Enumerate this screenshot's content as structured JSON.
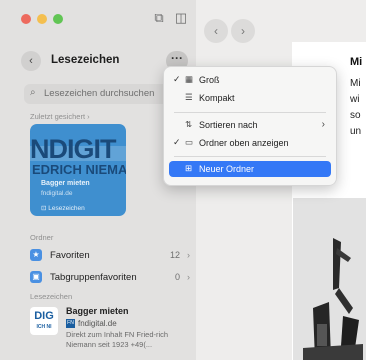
{
  "sidebar": {
    "title": "Lesezeichen",
    "back_icon": "‹",
    "more_icon": "···",
    "search_placeholder": "Lesezeichen durchsuchen",
    "recent_label": "Zuletzt gesichert",
    "recent_chevron": "›",
    "card": {
      "logo_line1": "NDIGIT",
      "logo_line2": "EDRICH NIEMA",
      "title": "Bagger mieten",
      "domain": "fndigital.de",
      "tag": "Lesezeichen"
    },
    "folder_label": "Ordner",
    "folders": [
      {
        "label": "Favoriten",
        "count": "12",
        "icon": "star-icon"
      },
      {
        "label": "Tabgruppenfavoriten",
        "count": "0",
        "icon": "tab-group-icon"
      }
    ],
    "bookmarks_label": "Lesezeichen",
    "bookmark": {
      "logo": "DIG",
      "logo_sub": "ICH NI",
      "title": "Bagger mieten",
      "fav": "FN",
      "domain": "fndigital.de",
      "desc": "Direkt zum Inhalt FN Fried-rich Niemann seit 1923 +49(..."
    }
  },
  "menu": {
    "items": [
      {
        "label": "Groß",
        "checked": true,
        "icon": "grid-icon"
      },
      {
        "label": "Kompakt",
        "checked": false,
        "icon": "list-icon"
      },
      {
        "label": "Sortieren nach",
        "checked": false,
        "icon": "sort-icon",
        "submenu": true
      },
      {
        "label": "Ordner oben anzeigen",
        "checked": true,
        "icon": "folder-icon"
      },
      {
        "label": "Neuer Ordner",
        "checked": false,
        "icon": "new-folder-icon",
        "highlighted": true
      }
    ]
  },
  "page": {
    "heading": "Mi",
    "lines": [
      "Mi",
      "wi",
      "so",
      "un"
    ]
  },
  "colors": {
    "accent": "#3478f6",
    "card": "#3f8fcf",
    "close": "#ed6a5e",
    "minimize": "#f4bf4f",
    "zoom": "#61c554"
  }
}
